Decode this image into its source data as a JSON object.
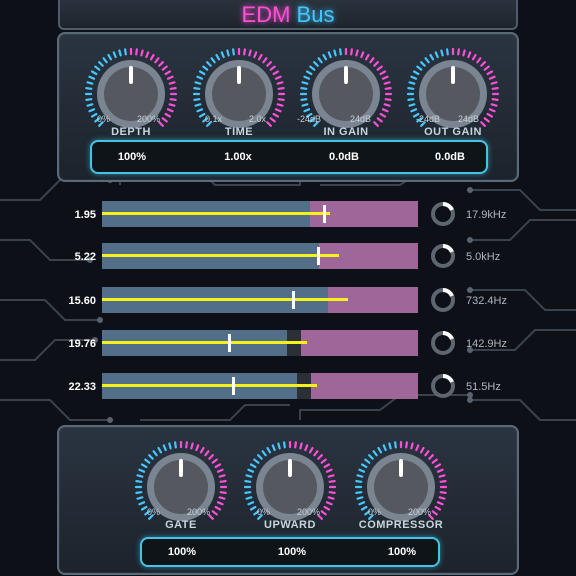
{
  "title": {
    "part1": "EDM",
    "part2": "Bus"
  },
  "colors": {
    "pink": "#ff4fd8",
    "cyan": "#46c6ff",
    "yellow": "#f5f11a"
  },
  "top_knobs": [
    {
      "name": "DEPTH",
      "min": "0%",
      "max": "200%",
      "readout": "100%"
    },
    {
      "name": "TIME",
      "min": "0.1x",
      "max": "2.0x",
      "readout": "1.00x"
    },
    {
      "name": "IN GAIN",
      "min": "-24dB",
      "max": "24dB",
      "readout": "0.0dB"
    },
    {
      "name": "OUT GAIN",
      "min": "-24dB",
      "max": "24dB",
      "readout": "0.0dB"
    }
  ],
  "bands": [
    {
      "value": "1.95",
      "freq": "17.9kHz",
      "level": 0.72,
      "thumb": 0.7
    },
    {
      "value": "5.22",
      "freq": "5.0kHz",
      "level": 0.75,
      "thumb": 0.68
    },
    {
      "value": "15.60",
      "freq": "732.4Hz",
      "level": 0.78,
      "thumb": 0.6
    },
    {
      "value": "19.76",
      "freq": "142.9Hz",
      "level": 0.65,
      "thumb": 0.4
    },
    {
      "value": "22.33",
      "freq": "51.5Hz",
      "level": 0.68,
      "thumb": 0.41
    }
  ],
  "bottom_knobs": [
    {
      "name": "GATE",
      "min": "0%",
      "max": "200%",
      "readout": "100%"
    },
    {
      "name": "UPWARD",
      "min": "0%",
      "max": "200%",
      "readout": "100%"
    },
    {
      "name": "COMPRESSOR",
      "min": "0%",
      "max": "200%",
      "readout": "100%"
    }
  ]
}
